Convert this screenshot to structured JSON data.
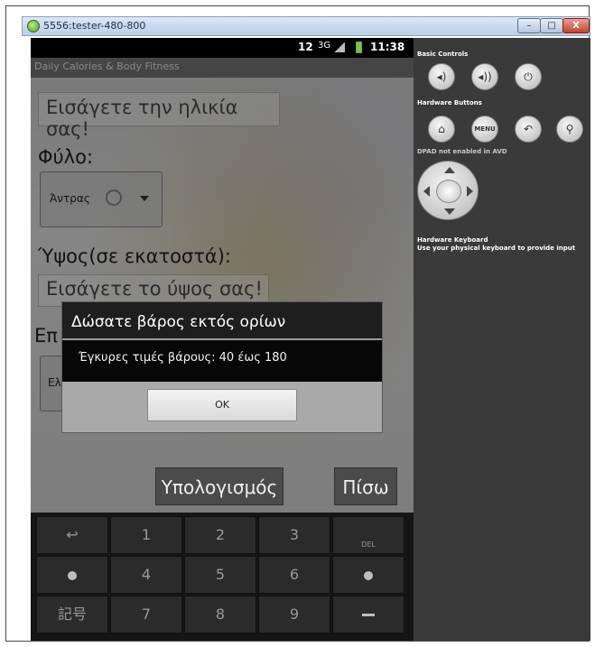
{
  "window": {
    "title": "5556:tester-480-800",
    "minimize_label": "–",
    "maximize_label": "□",
    "close_label": "X"
  },
  "status_bar": {
    "sim": "12",
    "network": "3G",
    "time": "11:38"
  },
  "app": {
    "title": "Daily Calories & Body Fitness",
    "age_placeholder": "Εισάγετε την ηλικία σας!",
    "sex_label": "Φύλο:",
    "sex_value": "Άντρας",
    "height_label": "Ύψος(σε εκατοστά):",
    "height_placeholder": "Εισάγετε το ύψος σας!",
    "weight_label": "Επ",
    "weight_spinner_text": "Ελ",
    "calculate_button": "Υπολογισμός",
    "back_button": "Πίσω"
  },
  "dialog": {
    "title": "Δώσατε βάρος εκτός ορίων",
    "message": "Έγκυρες τιμές βάρους: 40 έως 180",
    "ok_button": "OK"
  },
  "keyboard": {
    "rows": [
      [
        "↩",
        "1",
        "2",
        "3",
        "DEL"
      ],
      [
        "●",
        "4",
        "5",
        "6",
        "●"
      ],
      [
        "記号",
        "7",
        "8",
        "9",
        "—"
      ]
    ]
  },
  "panel": {
    "basic_controls_label": "Basic Controls",
    "hardware_buttons_label": "Hardware Buttons",
    "menu_label": "MENU",
    "dpad_label": "DPAD not enabled in AVD",
    "keyboard_label_1": "Hardware Keyboard",
    "keyboard_label_2": "Use your physical keyboard to provide input"
  }
}
